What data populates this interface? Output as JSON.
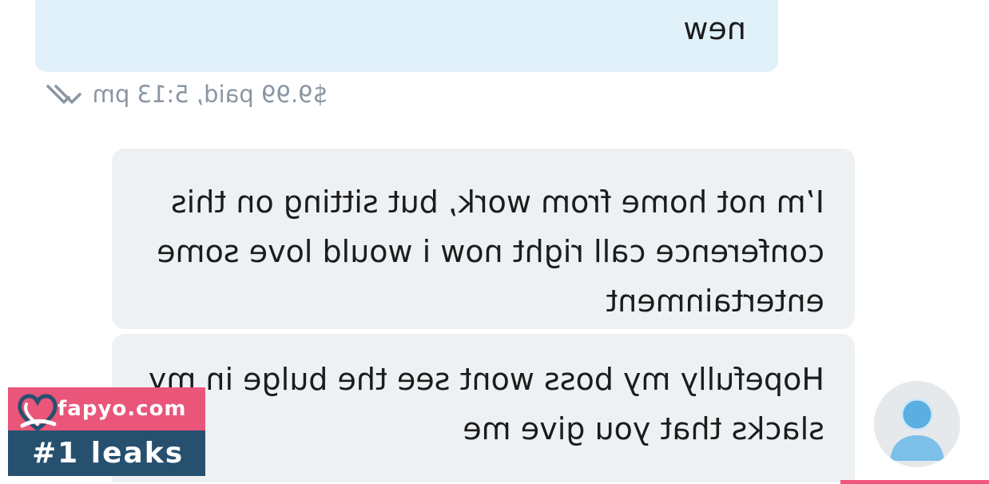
{
  "chat": {
    "sent_message": {
      "text": "new",
      "meta": "$9.99 paid, 5:13 pm",
      "status_icon": "double-check-icon",
      "bubble_color": "#e1f1fa"
    },
    "received_messages": [
      {
        "text": "I’m not home from work, but sitting on this conference call right now i would love some entertainment"
      },
      {
        "text": "Hopefully my boss wont see the bulge in my slacks that you give me"
      }
    ],
    "received_bubble_color": "#eef1f3",
    "avatar_icon": "user-silhouette-icon"
  },
  "watermark": {
    "site": "fapyo.com",
    "tagline": "#1 leaks",
    "logo_icon": "heart-lock-logo",
    "colors": {
      "top": "#e9567a",
      "bottom": "#27506f"
    }
  },
  "accent_color": "#f0577f"
}
